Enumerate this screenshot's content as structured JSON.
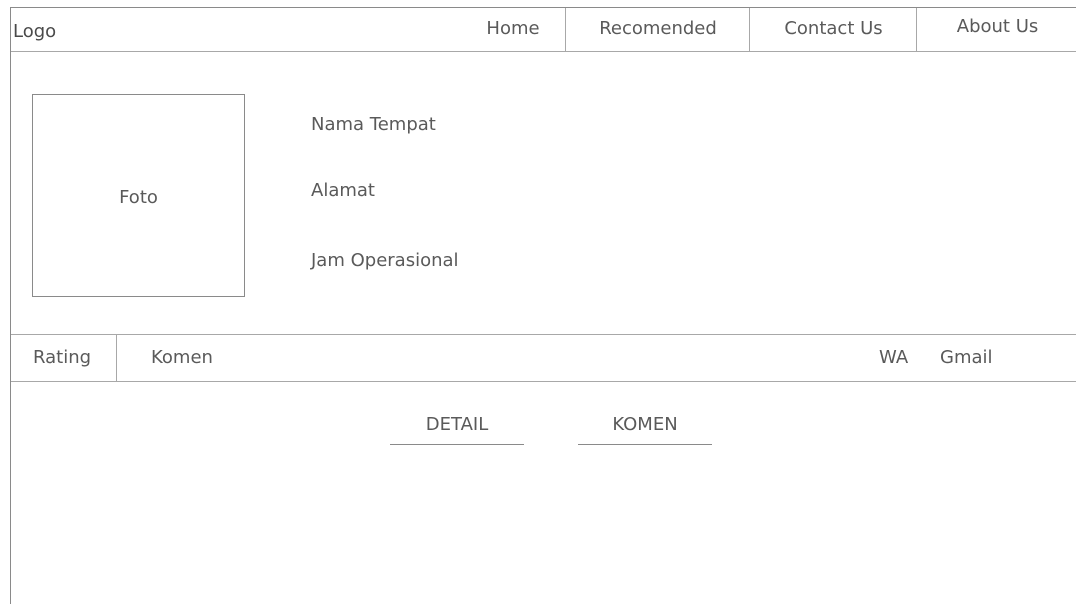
{
  "header": {
    "logo": "Logo",
    "nav": {
      "home": "Home",
      "recomended": "Recomended",
      "contact": "Contact Us",
      "about": "About Us"
    }
  },
  "place": {
    "photo_label": "Foto",
    "name": "Nama Tempat",
    "address": "Alamat",
    "hours": "Jam Operasional"
  },
  "subbar": {
    "rating": "Rating",
    "komen": "Komen",
    "wa": "WA",
    "gmail": "Gmail"
  },
  "tabs": {
    "detail": "DETAIL",
    "komen": "KOMEN"
  }
}
